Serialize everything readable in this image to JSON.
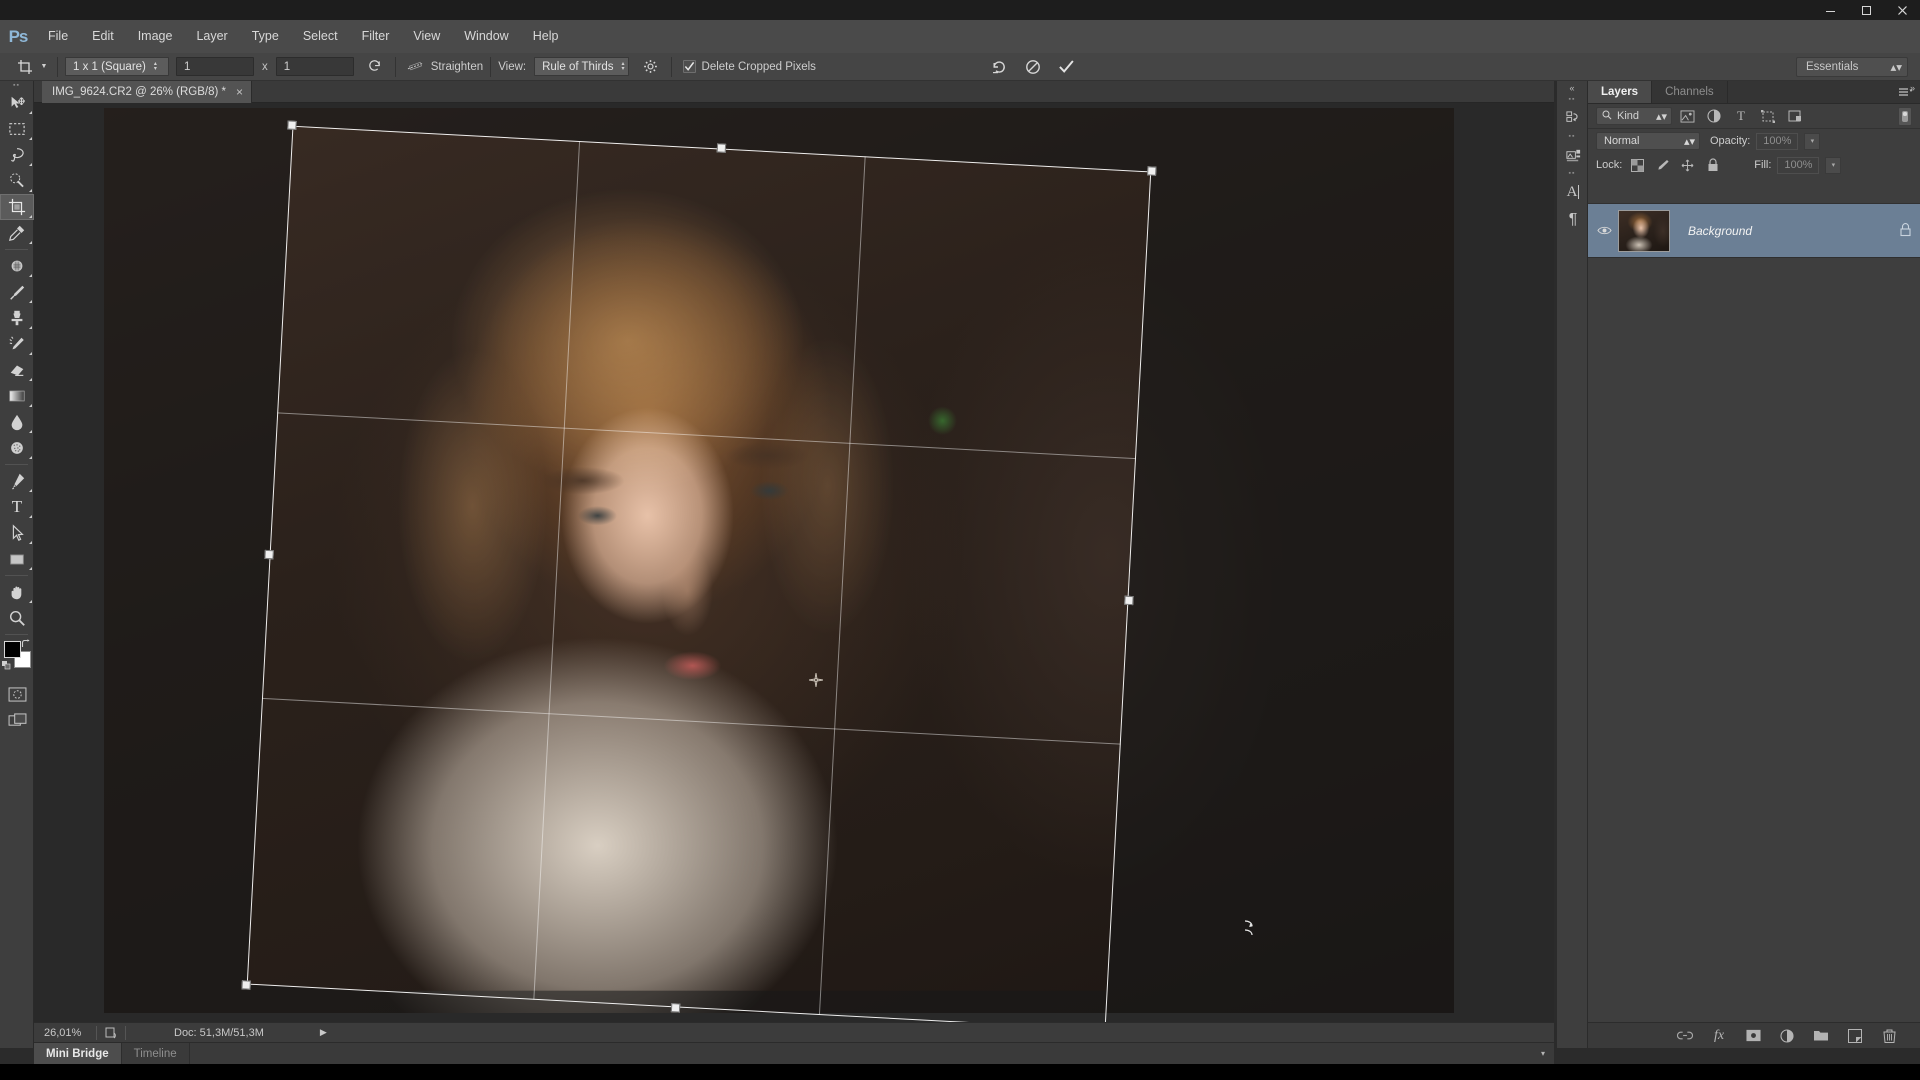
{
  "app": {
    "name": "Adobe Photoshop",
    "logo_text": "Ps",
    "accent": "#8fb8d8",
    "panel_bg": "#3e3e3e",
    "selection_blue": "#6b7f95"
  },
  "titlebar": {
    "minimize": "minimize-icon",
    "maximize": "maximize-icon",
    "close": "close-icon"
  },
  "menubar": {
    "items": [
      {
        "label": "File"
      },
      {
        "label": "Edit"
      },
      {
        "label": "Image"
      },
      {
        "label": "Layer"
      },
      {
        "label": "Type"
      },
      {
        "label": "Select"
      },
      {
        "label": "Filter"
      },
      {
        "label": "View"
      },
      {
        "label": "Window"
      },
      {
        "label": "Help"
      }
    ]
  },
  "options_bar": {
    "tool_icon": "crop-tool-icon",
    "ratio_preset": "1 x 1 (Square)",
    "width_value": "1",
    "x_separator": "x",
    "height_value": "1",
    "swap_icon": "swap-dimensions-icon",
    "straighten_icon": "straighten-icon",
    "straighten_label": "Straighten",
    "view_label": "View:",
    "overlay_preset": "Rule of Thirds",
    "settings_icon": "gear-icon",
    "delete_cropped_label": "Delete Cropped Pixels",
    "delete_cropped_checked": true,
    "reset_icon": "reset-icon",
    "cancel_icon": "cancel-icon",
    "commit_icon": "commit-checkmark-icon",
    "workspace": "Essentials"
  },
  "document": {
    "tab_title": "IMG_9624.CR2 @ 26% (RGB/8) *",
    "close_glyph": "×"
  },
  "toolbar": {
    "tools": [
      {
        "name": "move-tool",
        "glyph": "move",
        "active": false,
        "has_flyout": true
      },
      {
        "name": "rectangular-marquee-tool",
        "glyph": "marquee",
        "active": false,
        "has_flyout": true
      },
      {
        "name": "lasso-tool",
        "glyph": "lasso",
        "active": false,
        "has_flyout": true
      },
      {
        "name": "quick-selection-tool",
        "glyph": "quickselect",
        "active": false,
        "has_flyout": true
      },
      {
        "name": "crop-tool",
        "glyph": "crop",
        "active": true,
        "has_flyout": true
      },
      {
        "name": "eyedropper-tool",
        "glyph": "eyedropper",
        "active": false,
        "has_flyout": true
      },
      {
        "name": "spot-healing-brush-tool",
        "glyph": "healing",
        "active": false,
        "has_flyout": true
      },
      {
        "name": "brush-tool",
        "glyph": "brush",
        "active": false,
        "has_flyout": true
      },
      {
        "name": "clone-stamp-tool",
        "glyph": "stamp",
        "active": false,
        "has_flyout": true
      },
      {
        "name": "history-brush-tool",
        "glyph": "historybrush",
        "active": false,
        "has_flyout": true
      },
      {
        "name": "eraser-tool",
        "glyph": "eraser",
        "active": false,
        "has_flyout": true
      },
      {
        "name": "gradient-tool",
        "glyph": "gradient",
        "active": false,
        "has_flyout": true
      },
      {
        "name": "blur-tool",
        "glyph": "blur",
        "active": false,
        "has_flyout": true
      },
      {
        "name": "dodge-tool",
        "glyph": "dodge",
        "active": false,
        "has_flyout": true
      },
      {
        "name": "pen-tool",
        "glyph": "pen",
        "active": false,
        "has_flyout": true
      },
      {
        "name": "type-tool",
        "glyph": "type",
        "active": false,
        "has_flyout": true
      },
      {
        "name": "path-selection-tool",
        "glyph": "pathselect",
        "active": false,
        "has_flyout": true
      },
      {
        "name": "rectangle-shape-tool",
        "glyph": "shape",
        "active": false,
        "has_flyout": true
      },
      {
        "name": "hand-tool",
        "glyph": "hand",
        "active": false,
        "has_flyout": true
      },
      {
        "name": "zoom-tool",
        "glyph": "zoom",
        "active": false,
        "has_flyout": false
      }
    ],
    "foreground_color": "#000000",
    "background_color": "#ffffff",
    "quick_mask": "quick-mask-icon",
    "screen_mode": "screen-mode-icon"
  },
  "canvas": {
    "crop_overlay": "rule-of-thirds",
    "rotation_deg": "3.05",
    "rotation_center_icon": "rotation-center-icon",
    "cursor_icon": "rotate-cursor-icon",
    "handles": [
      "top-left",
      "top-center",
      "top-right",
      "middle-left",
      "middle-right",
      "bottom-left",
      "bottom-center",
      "bottom-right"
    ]
  },
  "statusbar": {
    "zoom_level": "26,01%",
    "preview_icon": "document-preview-icon",
    "doc_info": "Doc: 51,3M/51,3M",
    "expand_glyph": "▶"
  },
  "bottom_tabs": {
    "items": [
      {
        "label": "Mini Bridge",
        "active": true
      },
      {
        "label": "Timeline",
        "active": false
      }
    ],
    "caret_glyph": "▾"
  },
  "dock_icons": [
    {
      "name": "history-panel-icon"
    },
    {
      "name": "properties-panel-icon"
    },
    {
      "name": "character-panel-icon",
      "glyph": "A"
    },
    {
      "name": "paragraph-panel-icon",
      "glyph": "¶"
    }
  ],
  "layers_panel": {
    "tabs": [
      {
        "label": "Layers",
        "active": true
      },
      {
        "label": "Channels",
        "active": false
      }
    ],
    "menu_icon": "panel-menu-icon",
    "filter": {
      "search_icon": "search-icon",
      "kind_label": "Kind",
      "icons": [
        {
          "name": "filter-pixel-icon"
        },
        {
          "name": "filter-adjustment-icon"
        },
        {
          "name": "filter-type-icon"
        },
        {
          "name": "filter-shape-icon"
        },
        {
          "name": "filter-smart-object-icon"
        }
      ],
      "toggle_name": "filter-toggle-switch"
    },
    "blend_mode": "Normal",
    "opacity_label": "Opacity:",
    "opacity_value": "100%",
    "lock_label": "Lock:",
    "lock_icons": [
      {
        "name": "lock-transparent-pixels-icon"
      },
      {
        "name": "lock-image-pixels-icon"
      },
      {
        "name": "lock-position-icon"
      },
      {
        "name": "lock-all-icon"
      }
    ],
    "fill_label": "Fill:",
    "fill_value": "100%",
    "layers": [
      {
        "name": "Background",
        "selected": true,
        "visible": true,
        "locked": true,
        "thumbnail": "portrait-thumbnail"
      }
    ],
    "footer_icons": [
      {
        "name": "link-layers-icon"
      },
      {
        "name": "layer-style-fx-icon"
      },
      {
        "name": "add-layer-mask-icon"
      },
      {
        "name": "new-adjustment-layer-icon"
      },
      {
        "name": "new-group-icon"
      },
      {
        "name": "new-layer-icon"
      },
      {
        "name": "delete-layer-icon"
      }
    ]
  }
}
